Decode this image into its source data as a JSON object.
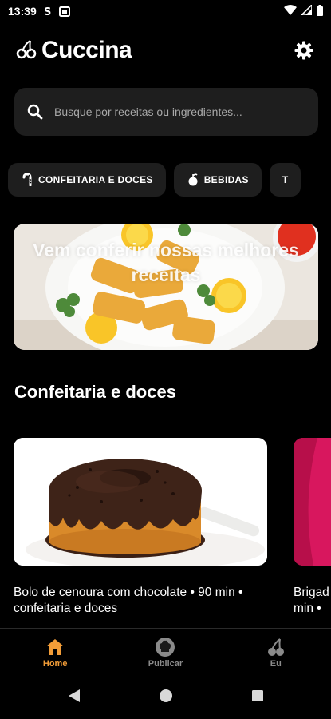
{
  "status_bar": {
    "time": "13:39"
  },
  "header": {
    "title": "Cuccina"
  },
  "search": {
    "placeholder": "Busque por receitas ou ingredientes..."
  },
  "categories": [
    {
      "label": "CONFEITARIA E DOCES",
      "icon": "candy-cane-icon"
    },
    {
      "label": "BEBIDAS",
      "icon": "fruit-icon"
    },
    {
      "label": "T",
      "icon": "partial-icon"
    }
  ],
  "banner": {
    "text": "Vem conferir nossas melhores receitas"
  },
  "section": {
    "title": "Confeitaria e doces"
  },
  "recipes": [
    {
      "caption": "Bolo de cenoura com chocolate  • 90 min • confeitaria e doces"
    },
    {
      "caption": "Brigad min •"
    }
  ],
  "bottom_nav": [
    {
      "label": "Home",
      "icon": "home-icon",
      "active": true
    },
    {
      "label": "Publicar",
      "icon": "chef-hat-icon",
      "active": false
    },
    {
      "label": "Eu",
      "icon": "cherries-icon",
      "active": false
    }
  ],
  "colors": {
    "accent": "#f29d38",
    "background": "#000000",
    "surface": "#1e1e1e"
  }
}
